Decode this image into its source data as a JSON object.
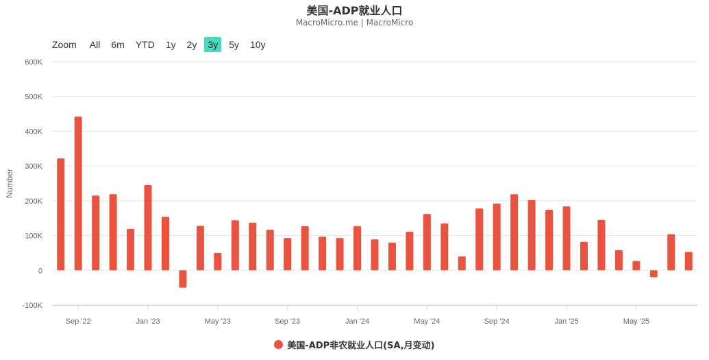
{
  "header": {
    "title": "美国-ADP就业人口",
    "subtitle": "MacroMicro.me | MacroMicro"
  },
  "zoom": {
    "label": "Zoom",
    "buttons": [
      "All",
      "6m",
      "YTD",
      "1y",
      "2y",
      "3y",
      "5y",
      "10y"
    ],
    "active": "3y"
  },
  "colors": {
    "bar": "#e8543f",
    "grid": "#e6e6e6",
    "axis_text": "#666666",
    "zoom_active": "#4ad9c0"
  },
  "chart_data": {
    "type": "bar",
    "ylabel": "Number",
    "ylim": [
      -100000,
      600000
    ],
    "yticks": [
      -100000,
      0,
      100000,
      200000,
      300000,
      400000,
      500000,
      600000
    ],
    "ytick_labels": [
      "-100K",
      "0",
      "100K",
      "200K",
      "300K",
      "400K",
      "500K",
      "600K"
    ],
    "xticks": [
      {
        "date": "2022-09",
        "label": "Sep '22"
      },
      {
        "date": "2023-01",
        "label": "Jan '23"
      },
      {
        "date": "2023-05",
        "label": "May '23"
      },
      {
        "date": "2023-09",
        "label": "Sep '23"
      },
      {
        "date": "2024-01",
        "label": "Jan '24"
      },
      {
        "date": "2024-05",
        "label": "May '24"
      },
      {
        "date": "2024-09",
        "label": "Sep '24"
      },
      {
        "date": "2025-01",
        "label": "Jan '25"
      },
      {
        "date": "2025-05",
        "label": "May '25"
      }
    ],
    "categories": [
      "2022-08",
      "2022-09",
      "2022-10",
      "2022-11",
      "2022-12",
      "2023-01",
      "2023-02",
      "2023-03",
      "2023-04",
      "2023-05",
      "2023-06",
      "2023-07",
      "2023-08",
      "2023-09",
      "2023-10",
      "2023-11",
      "2023-12",
      "2024-01",
      "2024-02",
      "2024-03",
      "2024-04",
      "2024-05",
      "2024-06",
      "2024-07",
      "2024-08",
      "2024-09",
      "2024-10",
      "2024-11",
      "2024-12",
      "2025-01",
      "2025-02",
      "2025-03",
      "2025-04",
      "2025-05",
      "2025-06",
      "2025-07",
      "2025-08"
    ],
    "series": [
      {
        "name": "美国-ADP非农就业人口(SA,月变动)",
        "values": [
          322000,
          442000,
          215000,
          219000,
          119000,
          245000,
          154000,
          -50000,
          128000,
          50000,
          144000,
          137000,
          117000,
          93000,
          127000,
          97000,
          93000,
          127000,
          89000,
          80000,
          111000,
          162000,
          135000,
          40000,
          178000,
          192000,
          219000,
          202000,
          174000,
          184000,
          82000,
          145000,
          58000,
          27000,
          -20000,
          104000,
          53000
        ]
      }
    ]
  }
}
